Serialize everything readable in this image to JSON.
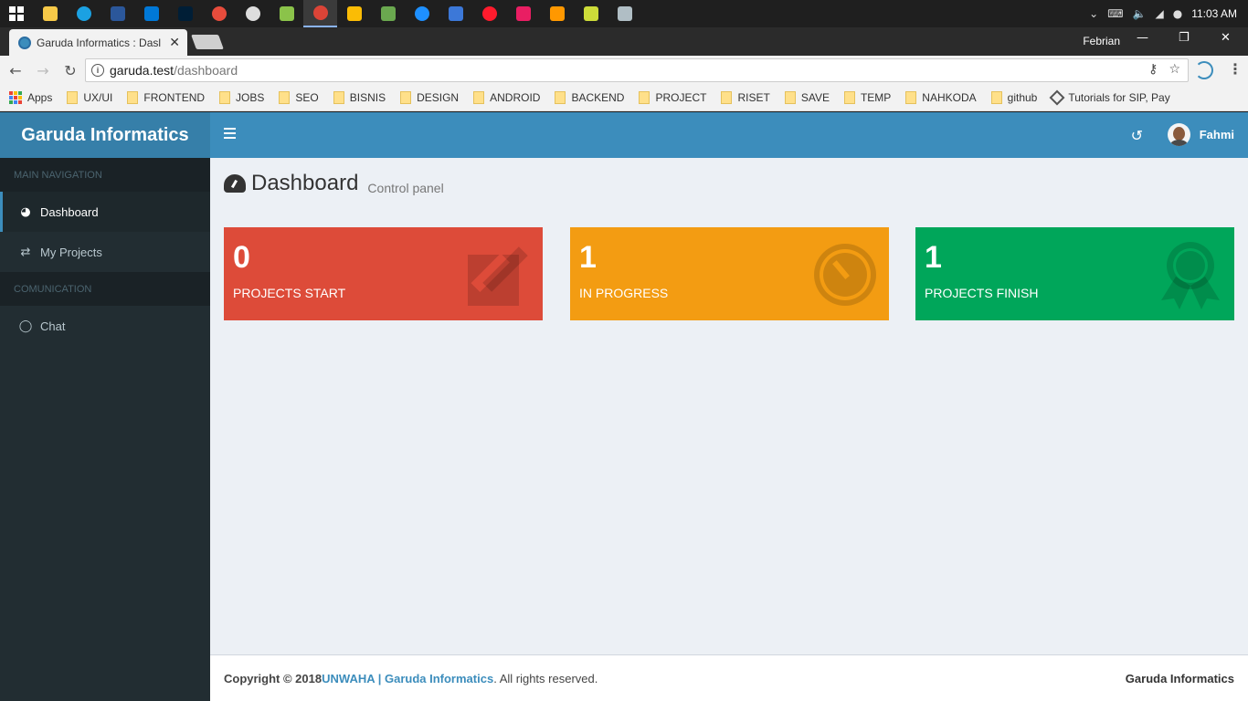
{
  "taskbar": {
    "icons": [
      {
        "name": "file-explorer-icon",
        "color": "#f7c948"
      },
      {
        "name": "search-app-icon",
        "color": "#1ba1e2"
      },
      {
        "name": "word-icon",
        "color": "#2b579a"
      },
      {
        "name": "settings-app-icon",
        "color": "#0078d7"
      },
      {
        "name": "photoshop-icon",
        "color": "#001e36"
      },
      {
        "name": "color-wheel-icon",
        "color": "#e74c3c"
      },
      {
        "name": "obs-icon",
        "color": "#dddddd"
      },
      {
        "name": "notepad-plus-icon",
        "color": "#8bc34a"
      },
      {
        "name": "chrome-icon",
        "color": "#db4437"
      },
      {
        "name": "keep-icon",
        "color": "#fbbc05"
      },
      {
        "name": "lambda-app-icon",
        "color": "#6aa84f"
      },
      {
        "name": "edge-icon",
        "color": "#1e90ff"
      },
      {
        "name": "remote-desktop-icon",
        "color": "#3c78d8"
      },
      {
        "name": "opera-icon",
        "color": "#ff1b2d"
      },
      {
        "name": "app-red-icon",
        "color": "#e91e63"
      },
      {
        "name": "sublime-icon",
        "color": "#ff9800"
      },
      {
        "name": "hs-app-icon",
        "color": "#cddc39"
      },
      {
        "name": "window-app-icon",
        "color": "#b0bec5"
      }
    ],
    "clock": "11:03 AM"
  },
  "browser": {
    "tab_title": "Garuda Informatics : Dasl",
    "user": "Febrian",
    "url_host": "garuda.test",
    "url_path": "/dashboard",
    "bookmarks": [
      {
        "label": "Apps",
        "type": "apps"
      },
      {
        "label": "UX/UI",
        "type": "folder"
      },
      {
        "label": "FRONTEND",
        "type": "folder"
      },
      {
        "label": "JOBS",
        "type": "folder"
      },
      {
        "label": "SEO",
        "type": "folder"
      },
      {
        "label": "BISNIS",
        "type": "folder"
      },
      {
        "label": "DESIGN",
        "type": "folder"
      },
      {
        "label": "ANDROID",
        "type": "folder"
      },
      {
        "label": "BACKEND",
        "type": "folder"
      },
      {
        "label": "PROJECT",
        "type": "folder"
      },
      {
        "label": "RISET",
        "type": "folder"
      },
      {
        "label": "SAVE",
        "type": "folder"
      },
      {
        "label": "TEMP",
        "type": "folder"
      },
      {
        "label": "NAHKODA",
        "type": "folder"
      },
      {
        "label": "github",
        "type": "folder"
      },
      {
        "label": "Tutorials for SIP, Pay",
        "type": "link"
      }
    ]
  },
  "app": {
    "brand": "Garuda Informatics",
    "user_name": "Fahmi",
    "sidebar": {
      "header_main": "MAIN NAVIGATION",
      "header_comm": "COMUNICATION",
      "items": [
        {
          "label": "Dashboard",
          "icon": "dashboard-icon"
        },
        {
          "label": "My Projects",
          "icon": "exchange-icon"
        },
        {
          "label": "Chat",
          "icon": "comment-icon"
        }
      ]
    },
    "page_title": "Dashboard",
    "page_subtitle": "Control panel",
    "boxes": [
      {
        "count": "0",
        "label": "PROJECTS START",
        "color": "#dd4b39",
        "icon": "edit-icon"
      },
      {
        "count": "1",
        "label": "IN PROGRESS",
        "color": "#f39c12",
        "icon": "timer-icon"
      },
      {
        "count": "1",
        "label": "PROJECTS FINISH",
        "color": "#00a65a",
        "icon": "award-icon"
      }
    ],
    "footer": {
      "copyright": "Copyright © 2018 ",
      "link": "UNWAHA | Garuda Informatics",
      "suffix": ". All rights reserved.",
      "right": "Garuda Informatics"
    }
  }
}
